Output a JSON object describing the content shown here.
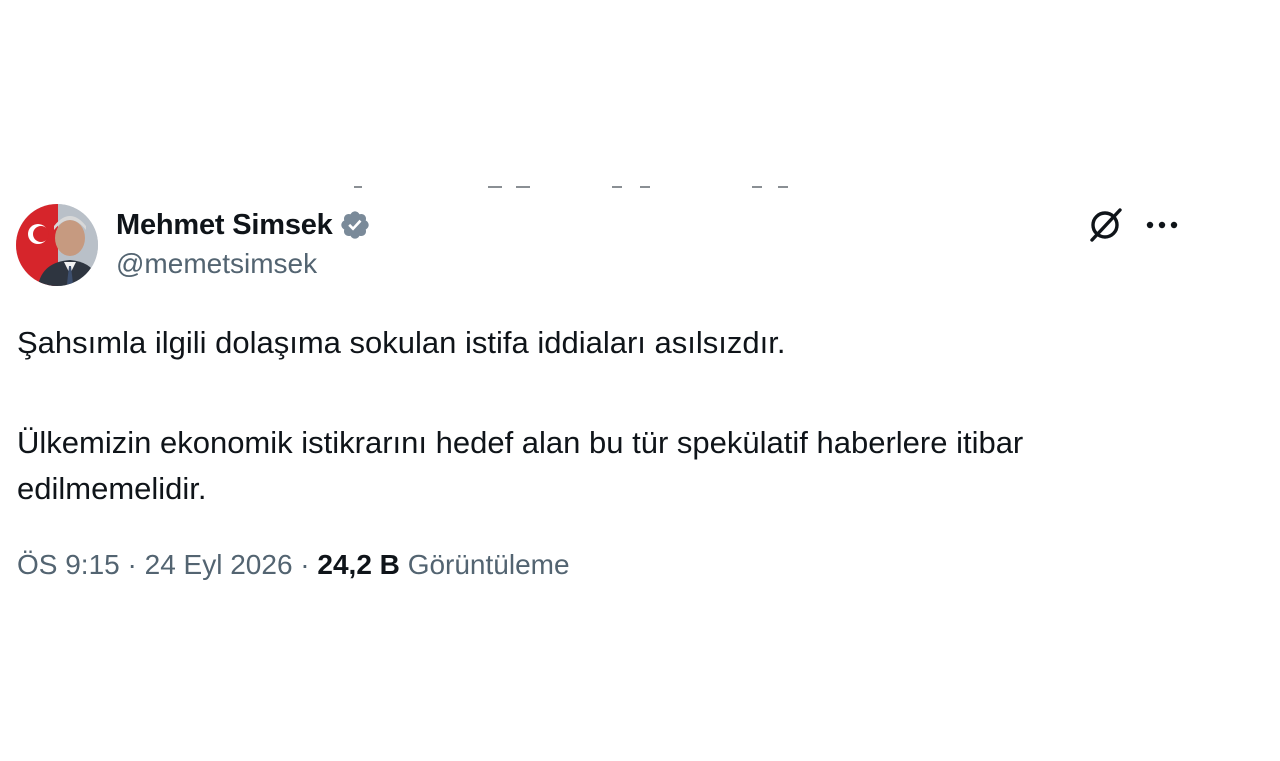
{
  "author": {
    "display_name": "Mehmet Simsek",
    "handle": "@memetsimsek",
    "verified": true
  },
  "tweet": {
    "paragraphs": [
      "Şahsımla ilgili dolaşıma sokulan istifa iddiaları asılsızdır.",
      "Ülkemizin ekonomik istikrarını hedef alan bu tür spekülatif haberlere itibar edilmemelidir."
    ],
    "time": "ÖS 9:15",
    "separator": "·",
    "date": "24 Eyl 2026",
    "views_count": "24,2 B",
    "views_label": "Görüntüleme"
  },
  "icons": {
    "verified": "verified-badge-icon",
    "grok": "grok-icon",
    "more": "more-dots-icon"
  },
  "colors": {
    "text_primary": "#0f1419",
    "text_secondary": "#536471",
    "verified_badge": "#7a8a99",
    "background": "#ffffff"
  }
}
